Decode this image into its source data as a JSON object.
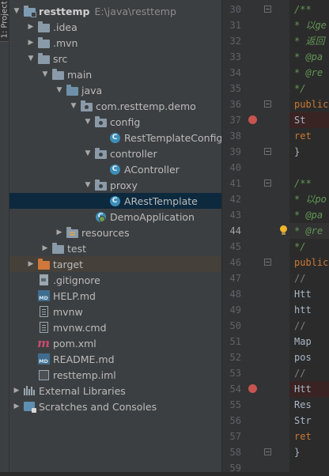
{
  "sidebar_tab": {
    "label": "1: Project"
  },
  "tree": [
    {
      "id": "root",
      "label": "resttemp",
      "path": "E:\\java\\resttemp",
      "expanded": true,
      "icon": "project-folder-icon",
      "level": 0
    },
    {
      "id": "idea",
      "label": ".idea",
      "expanded": false,
      "icon": "folder-icon",
      "level": 1
    },
    {
      "id": "mvn",
      "label": ".mvn",
      "expanded": false,
      "icon": "folder-icon",
      "level": 1
    },
    {
      "id": "src",
      "label": "src",
      "expanded": true,
      "icon": "folder-icon",
      "level": 1
    },
    {
      "id": "main",
      "label": "main",
      "expanded": true,
      "icon": "folder-icon",
      "level": 2
    },
    {
      "id": "java",
      "label": "java",
      "expanded": true,
      "icon": "source-folder-icon",
      "level": 3
    },
    {
      "id": "pkg",
      "label": "com.resttemp.demo",
      "expanded": true,
      "icon": "package-icon",
      "level": 4
    },
    {
      "id": "config",
      "label": "config",
      "expanded": true,
      "icon": "package-icon",
      "level": 5
    },
    {
      "id": "rtc",
      "label": "RestTemplateConfig",
      "icon": "class-icon",
      "level": 6
    },
    {
      "id": "controller",
      "label": "controller",
      "expanded": true,
      "icon": "package-icon",
      "level": 5
    },
    {
      "id": "actl",
      "label": "AController",
      "icon": "class-icon",
      "level": 6
    },
    {
      "id": "proxy",
      "label": "proxy",
      "expanded": true,
      "icon": "package-icon",
      "level": 5
    },
    {
      "id": "art",
      "label": "ARestTemplate",
      "icon": "class-icon",
      "level": 6,
      "selected": true
    },
    {
      "id": "demoapp",
      "label": "DemoApplication",
      "icon": "spring-boot-class-icon",
      "level": 5
    },
    {
      "id": "resources",
      "label": "resources",
      "expanded": false,
      "icon": "resources-folder-icon",
      "level": 3
    },
    {
      "id": "test",
      "label": "test",
      "expanded": false,
      "icon": "folder-icon",
      "level": 2
    },
    {
      "id": "target",
      "label": "target",
      "expanded": false,
      "icon": "excluded-folder-icon",
      "level": 1
    },
    {
      "id": "gitignore",
      "label": ".gitignore",
      "icon": "gitignore-file-icon",
      "level": 1
    },
    {
      "id": "help",
      "label": "HELP.md",
      "icon": "markdown-file-icon",
      "level": 1
    },
    {
      "id": "mvnw",
      "label": "mvnw",
      "icon": "script-file-icon",
      "level": 1
    },
    {
      "id": "mvnwcmd",
      "label": "mvnw.cmd",
      "icon": "script-file-icon",
      "level": 1
    },
    {
      "id": "pom",
      "label": "pom.xml",
      "icon": "maven-icon",
      "level": 1
    },
    {
      "id": "readme",
      "label": "README.md",
      "icon": "markdown-file-icon",
      "level": 1
    },
    {
      "id": "iml",
      "label": "resttemp.iml",
      "icon": "module-file-icon",
      "level": 1
    },
    {
      "id": "extlibs",
      "label": "External Libraries",
      "expanded": false,
      "icon": "libraries-icon",
      "level": 0
    },
    {
      "id": "scratches",
      "label": "Scratches and Consoles",
      "expanded": false,
      "icon": "scratches-icon",
      "level": 0
    }
  ],
  "md_badge": "MD",
  "class_badge": "C",
  "gutter": {
    "lines": [
      "30",
      "31",
      "32",
      "33",
      "34",
      "35",
      "36",
      "37",
      "38",
      "39",
      "40",
      "41",
      "42",
      "43",
      "44",
      "45",
      "46",
      "47",
      "48",
      "49",
      "50",
      "51",
      "52",
      "53",
      "54",
      "55",
      "56",
      "57",
      "58",
      "59"
    ],
    "current_line": "44",
    "breakpoints": [
      "37",
      "54"
    ],
    "bulb_line": "44"
  },
  "code": [
    {
      "line": "30",
      "text": "/**",
      "style": "doc"
    },
    {
      "line": "31",
      "text": " * 以ge",
      "style": "doc"
    },
    {
      "line": "32",
      "text": " * 返回",
      "style": "doc"
    },
    {
      "line": "33",
      "text": " * @pa",
      "style": "doc"
    },
    {
      "line": "34",
      "text": " * @re",
      "style": "doc"
    },
    {
      "line": "35",
      "text": " */",
      "style": "doc"
    },
    {
      "line": "36",
      "text": "public",
      "style": "kw"
    },
    {
      "line": "37",
      "text": "    St",
      "style": "txt"
    },
    {
      "line": "38",
      "text": "    ret",
      "style": "kw"
    },
    {
      "line": "39",
      "text": "}",
      "style": "txt"
    },
    {
      "line": "40",
      "text": "",
      "style": "txt"
    },
    {
      "line": "41",
      "text": "/**",
      "style": "doc"
    },
    {
      "line": "42",
      "text": " * 以po",
      "style": "doc"
    },
    {
      "line": "43",
      "text": " * @pa",
      "style": "doc"
    },
    {
      "line": "44",
      "text": " * @re",
      "style": "doc"
    },
    {
      "line": "45",
      "text": " */",
      "style": "doc"
    },
    {
      "line": "46",
      "text": "public",
      "style": "kw"
    },
    {
      "line": "47",
      "text": "    //",
      "style": "cmt"
    },
    {
      "line": "48",
      "text": "    Htt",
      "style": "txt"
    },
    {
      "line": "49",
      "text": "    htt",
      "style": "txt"
    },
    {
      "line": "50",
      "text": "    //",
      "style": "cmt"
    },
    {
      "line": "51",
      "text": "    Map",
      "style": "txt"
    },
    {
      "line": "52",
      "text": "    pos",
      "style": "txt"
    },
    {
      "line": "53",
      "text": "    //",
      "style": "cmt"
    },
    {
      "line": "54",
      "text": "    Htt",
      "style": "txt"
    },
    {
      "line": "55",
      "text": "    Res",
      "style": "txt"
    },
    {
      "line": "56",
      "text": "    Str",
      "style": "txt"
    },
    {
      "line": "57",
      "text": "    ret",
      "style": "kw"
    },
    {
      "line": "58",
      "text": "}",
      "style": "txt"
    },
    {
      "line": "59",
      "text": "",
      "style": "txt"
    }
  ]
}
